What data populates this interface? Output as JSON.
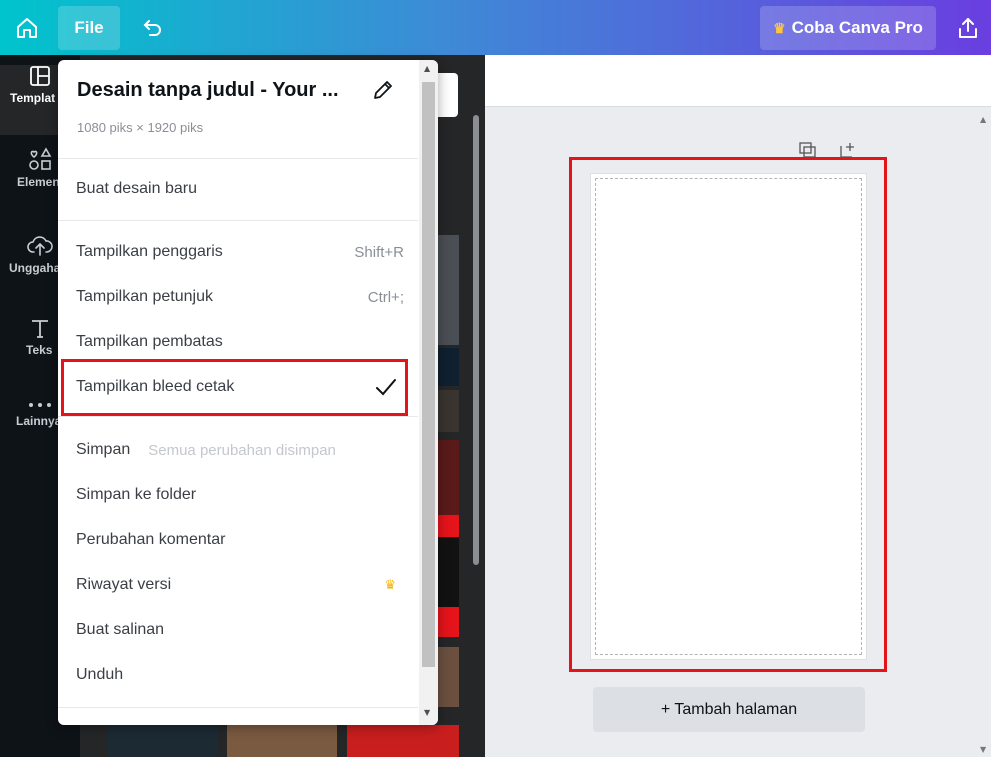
{
  "topbar": {
    "file_label": "File",
    "pro_label": "Coba Canva Pro",
    "pro_crown": "♛",
    "icons": {
      "home": "home-icon",
      "undo": "undo-icon",
      "share": "share-icon"
    },
    "gradient": [
      "#00c4cc",
      "#3e8ad6",
      "#6a3ee0"
    ]
  },
  "sidebar": {
    "items": [
      {
        "label": "Templat",
        "icon": "template-icon"
      },
      {
        "label": "Elemen",
        "icon": "elements-icon"
      },
      {
        "label": "Unggahan",
        "icon": "upload-icon"
      },
      {
        "label": "Teks",
        "icon": "text-icon"
      },
      {
        "label": "Lainnya",
        "icon": "more-icon"
      }
    ]
  },
  "file_menu": {
    "title": "Desain tanpa judul - Your ...",
    "dimensions": "1080 piks × 1920 piks",
    "new_design": "Buat desain baru",
    "view_items": [
      {
        "label": "Tampilkan penggaris",
        "shortcut": "Shift+R"
      },
      {
        "label": "Tampilkan petunjuk",
        "shortcut": "Ctrl+;"
      },
      {
        "label": "Tampilkan pembatas",
        "shortcut": ""
      },
      {
        "label": "Tampilkan bleed cetak",
        "shortcut": "",
        "checked": true
      }
    ],
    "save_label": "Simpan",
    "save_status": "Semua perubahan disimpan",
    "save_to_folder": "Simpan ke folder",
    "comment_changes": "Perubahan komentar",
    "version_history": "Riwayat versi",
    "version_crown": "♛",
    "make_copy": "Buat salinan",
    "download": "Unduh"
  },
  "canvas": {
    "add_page": "+ Tambah halaman"
  },
  "highlight_color": "#e5141b"
}
